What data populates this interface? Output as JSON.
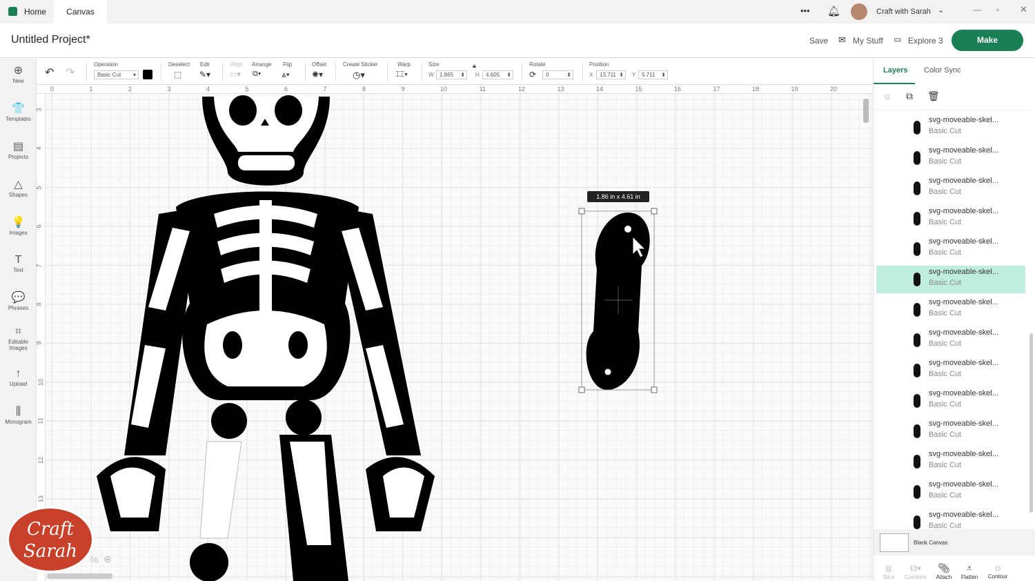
{
  "tabs": {
    "home": "Home",
    "canvas": "Canvas"
  },
  "topbar": {
    "more": "•••",
    "user": "Craft with Sarah"
  },
  "header": {
    "title": "Untitled Project*",
    "save": "Save",
    "my_stuff": "My Stuff",
    "machine": "Explore 3",
    "make": "Make"
  },
  "nav": [
    {
      "label": "New",
      "icon": "⊕"
    },
    {
      "label": "Templates",
      "icon": "👕"
    },
    {
      "label": "Projects",
      "icon": "▤"
    },
    {
      "label": "Shapes",
      "icon": "△"
    },
    {
      "label": "Images",
      "icon": "💡"
    },
    {
      "label": "Text",
      "icon": "T"
    },
    {
      "label": "Phrases",
      "icon": "💬"
    },
    {
      "label": "Editable Images",
      "icon": "⌗"
    },
    {
      "label": "Upload",
      "icon": "↑"
    },
    {
      "label": "Monogram",
      "icon": "⫼"
    }
  ],
  "toolbar": {
    "operation_label": "Operation",
    "operation_value": "Basic Cut",
    "deselect": "Deselect",
    "edit": "Edit",
    "align": "Align",
    "arrange": "Arrange",
    "flip": "Flip",
    "offset": "Offset",
    "create_sticker": "Create Sticker",
    "warp": "Warp",
    "size": "Size",
    "w_label": "W",
    "w": "1.865",
    "h_label": "H",
    "h": "4.605",
    "rotate": "Rotate",
    "rotate_value": "0",
    "position": "Position",
    "x_label": "X",
    "x": "13.711",
    "y_label": "Y",
    "y": "5.711"
  },
  "ruler": {
    "h": [
      "0",
      "1",
      "2",
      "3",
      "4",
      "5",
      "6",
      "7",
      "8",
      "9",
      "10",
      "11",
      "12",
      "13",
      "14",
      "15",
      "16",
      "17",
      "18",
      "19",
      "20"
    ],
    "v": [
      "3",
      "4",
      "5",
      "6",
      "7",
      "8",
      "9",
      "10",
      "11",
      "12",
      "13"
    ]
  },
  "selection": {
    "dimensions": "1.86  in x 4.61  in"
  },
  "panel": {
    "tab_layers": "Layers",
    "tab_color_sync": "Color Sync",
    "blank_canvas": "Blank Canvas",
    "layers": [
      {
        "name": "svg-moveable-skel...",
        "op": "Basic Cut"
      },
      {
        "name": "svg-moveable-skel...",
        "op": "Basic Cut"
      },
      {
        "name": "svg-moveable-skel...",
        "op": "Basic Cut"
      },
      {
        "name": "svg-moveable-skel...",
        "op": "Basic Cut"
      },
      {
        "name": "svg-moveable-skel...",
        "op": "Basic Cut"
      },
      {
        "name": "svg-moveable-skel...",
        "op": "Basic Cut"
      },
      {
        "name": "svg-moveable-skel...",
        "op": "Basic Cut"
      },
      {
        "name": "svg-moveable-skel...",
        "op": "Basic Cut"
      },
      {
        "name": "svg-moveable-skel...",
        "op": "Basic Cut"
      },
      {
        "name": "svg-moveable-skel...",
        "op": "Basic Cut"
      },
      {
        "name": "svg-moveable-skel...",
        "op": "Basic Cut"
      },
      {
        "name": "svg-moveable-skel...",
        "op": "Basic Cut"
      },
      {
        "name": "svg-moveable-skel...",
        "op": "Basic Cut"
      },
      {
        "name": "svg-moveable-skel...",
        "op": "Basic Cut"
      }
    ],
    "selected_index": 5,
    "bottom": {
      "slice": "Slice",
      "combine": "Combine",
      "attach": "Attach",
      "flatten": "Flatten",
      "contour": "Contour"
    }
  },
  "logo": {
    "text": "Craft with Sarah"
  },
  "zoom": "%",
  "colors": {
    "accent": "#1a7f55",
    "selected": "#bfeedd"
  }
}
